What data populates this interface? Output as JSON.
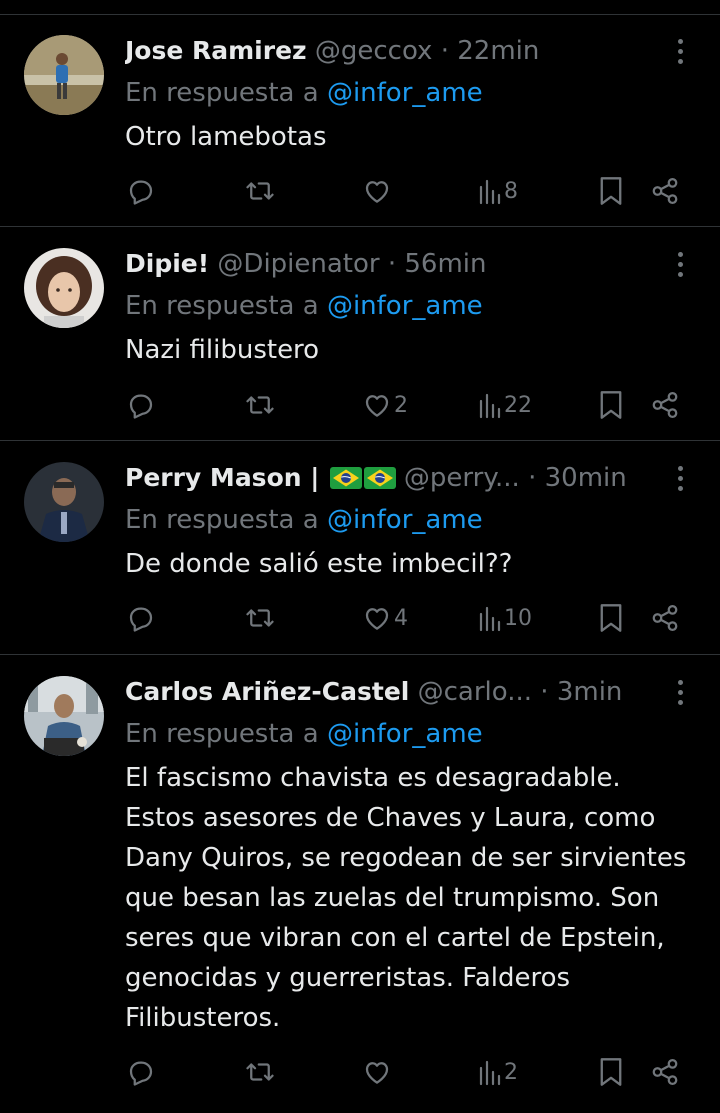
{
  "replies": [
    {
      "name": "Jose Ramirez",
      "handle": "@geccox",
      "separator": "·",
      "time": "22min",
      "reply_prefix": "En respuesta a",
      "reply_mention": "@infor_ame",
      "text": "Otro lamebotas",
      "likes": "",
      "views": "8"
    },
    {
      "name": "Dipie!",
      "handle": "@Dipienator",
      "separator": "·",
      "time": "56min",
      "reply_prefix": "En respuesta a",
      "reply_mention": "@infor_ame",
      "text": "Nazi filibustero",
      "likes": "2",
      "views": "22"
    },
    {
      "name": "Perry Mason |",
      "handle": "@perry...",
      "separator": "·",
      "time": "30min",
      "reply_prefix": "En respuesta a",
      "reply_mention": "@infor_ame",
      "text": "De donde salió este imbecil??",
      "likes": "4",
      "views": "10"
    },
    {
      "name": "Carlos Ariñez-Castel",
      "handle": "@carlo...",
      "separator": "·",
      "time": "3min",
      "reply_prefix": "En respuesta a",
      "reply_mention": "@infor_ame",
      "text": "El fascismo chavista es desagradable. Estos asesores de Chaves y Laura, como Dany Quiros, se regodean de ser sirvientes que besan las zuelas del trumpismo. Son seres que vibran con el cartel de Epstein, genocidas y guerreristas. Falderos Filibusteros.",
      "likes": "",
      "views": "2"
    }
  ],
  "colors": {
    "background": "#000000",
    "text": "#e7e9ea",
    "secondary": "#71767b",
    "mention": "#1d9bf0",
    "divider": "#2f3336"
  },
  "icons": [
    "reply-icon",
    "retweet-icon",
    "like-icon",
    "views-icon",
    "bookmark-icon",
    "share-icon",
    "more-icon",
    "brazil-flag-icon"
  ]
}
